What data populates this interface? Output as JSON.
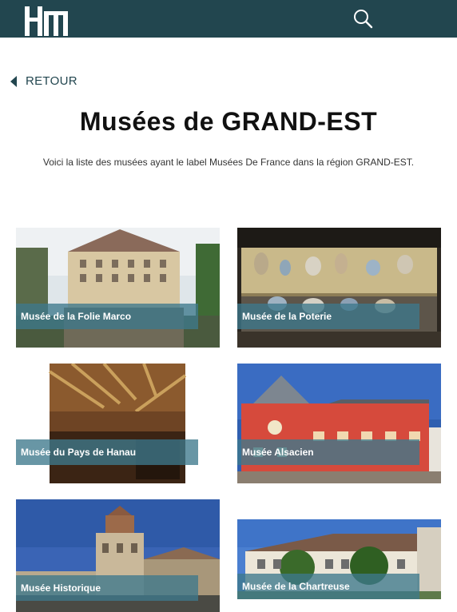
{
  "header": {
    "logo_icon": "hm-logo-icon",
    "search_icon": "search-icon",
    "background_color": "#22464f"
  },
  "nav": {
    "back_label": "RETOUR",
    "back_icon": "caret-left-icon"
  },
  "main": {
    "title": "Musées de GRAND-EST",
    "intro": "Voici la liste des musées ayant le label Musées De France dans la région GRAND-EST."
  },
  "museums": [
    {
      "name": "Musée de la Folie Marco"
    },
    {
      "name": "Musée de la Poterie"
    },
    {
      "name": "Musée du Pays de Hanau"
    },
    {
      "name": "Musée Alsacien"
    },
    {
      "name": "Musée Historique"
    },
    {
      "name": "Musée de la Chartreuse"
    }
  ],
  "colors": {
    "accent": "#22464f",
    "label_overlay": "#3e788c"
  }
}
